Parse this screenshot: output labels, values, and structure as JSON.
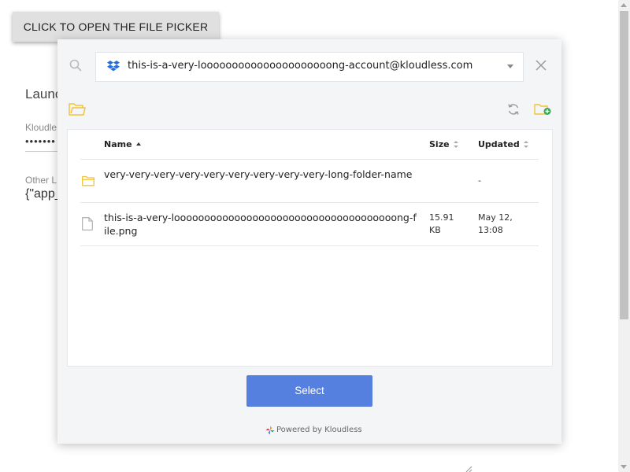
{
  "background_page": {
    "open_button_label": "CLICK TO OPEN THE FILE PICKER",
    "heading_partial": "Launc",
    "field_label_partial": "Kloudle",
    "password_masked": "•••••••",
    "other_label_partial": "Other L",
    "code_partial": "{\"app_"
  },
  "picker": {
    "account": {
      "provider_icon": "dropbox-icon",
      "email": "this-is-a-very-looooooooooooooooooooong-account@kloudless.com"
    },
    "table": {
      "columns": {
        "name": "Name",
        "size": "Size",
        "updated": "Updated"
      },
      "rows": [
        {
          "type": "folder",
          "icon": "folder-icon",
          "name": "very-very-very-very-very-very-very-very-very-long-folder-name",
          "size": "",
          "updated": "-"
        },
        {
          "type": "file",
          "icon": "file-icon",
          "name": "this-is-a-very-looooooooooooooooooooooooooooooooooooong-file.png",
          "size": "15.91 KB",
          "updated": "May 12, 13:08"
        }
      ]
    },
    "select_label": "Select",
    "powered_by": "Powered by Kloudless"
  },
  "colors": {
    "select_button": "#5680e0",
    "folder_icon": "#f0c33c",
    "new_folder_plus": "#3aa757",
    "dropbox": "#1f6fe0"
  }
}
